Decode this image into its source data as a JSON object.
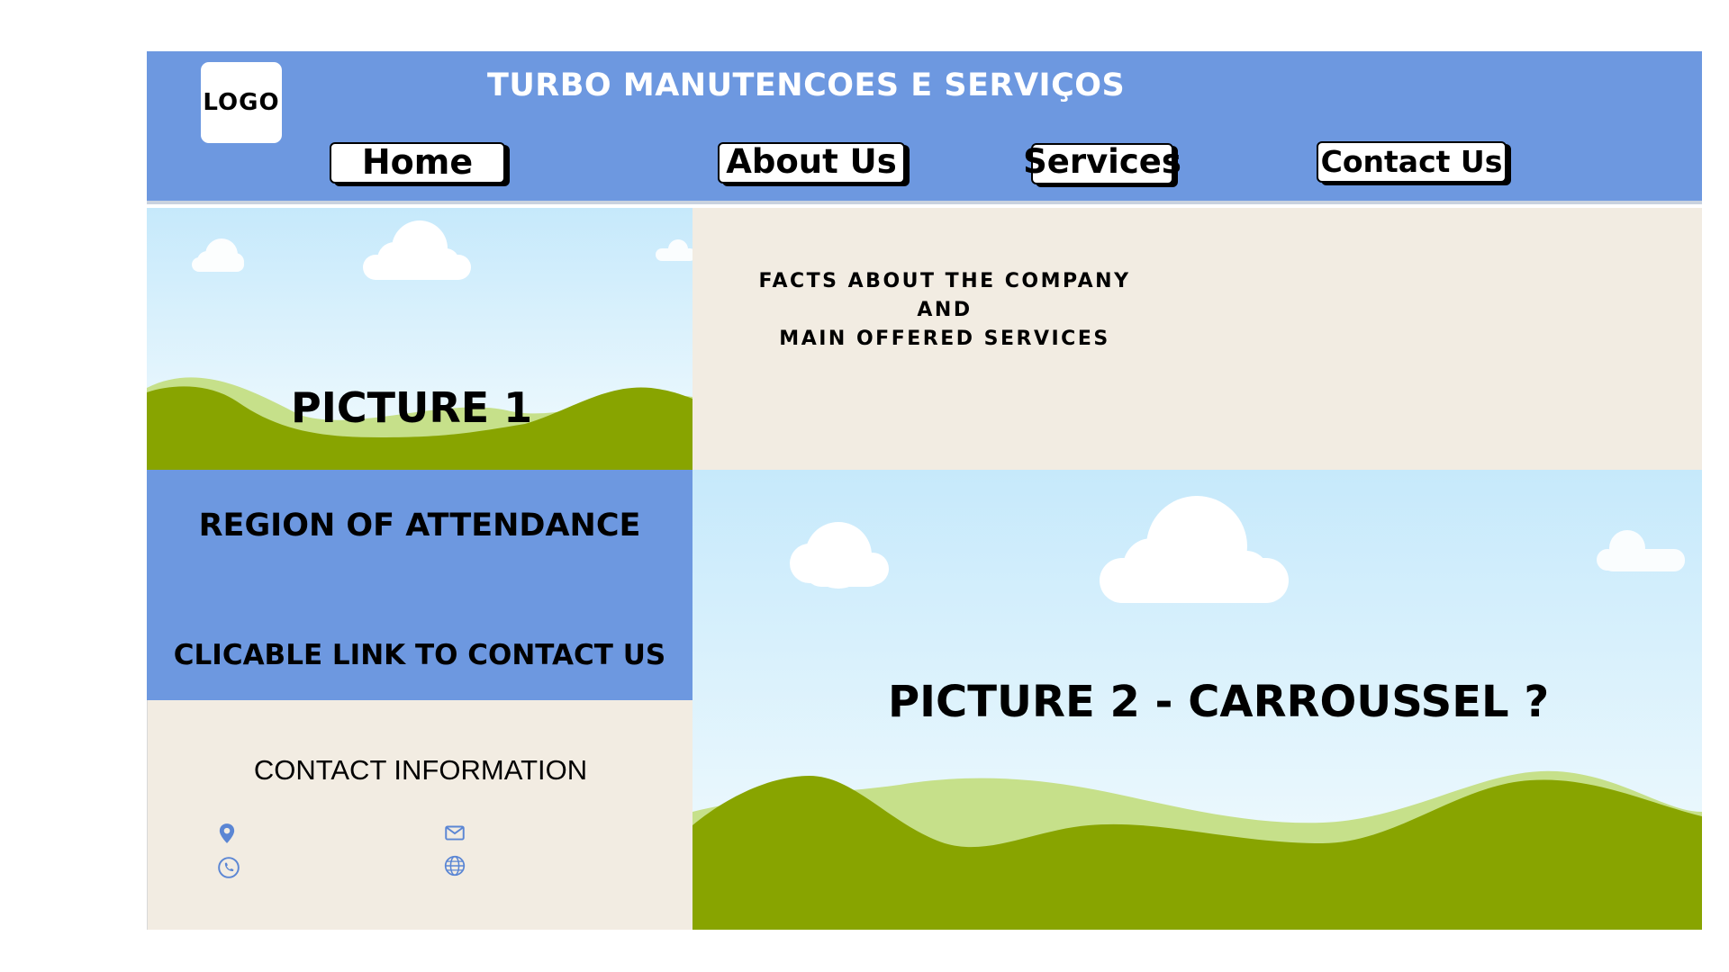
{
  "header": {
    "logo_text": "LOGO",
    "title": "TURBO MANUTENCOES E SERVIÇOS",
    "nav": {
      "home": "Home",
      "about": "About Us",
      "services": "Services",
      "contact": "Contact Us"
    },
    "bg_color": "#6d98e0"
  },
  "picture1": {
    "label": "PICTURE 1"
  },
  "facts": {
    "line1": "FACTS ABOUT THE COMPANY AND",
    "line2": "MAIN OFFERED SERVICES"
  },
  "region": {
    "title": "REGION OF ATTENDANCE",
    "link": "CLICABLE LINK TO CONTACT US"
  },
  "contact": {
    "title": "CONTACT INFORMATION",
    "icons": [
      "location-icon",
      "mail-icon",
      "phone-icon",
      "globe-icon"
    ],
    "icon_color": "#5b86d4"
  },
  "picture2": {
    "label": "PICTURE 2 - CARROUSSEL ?"
  },
  "colors": {
    "panel_beige": "#f2ece2",
    "hill_dark": "#88a400",
    "hill_light": "#c6e08a",
    "sky_top": "#c6e9fb"
  }
}
